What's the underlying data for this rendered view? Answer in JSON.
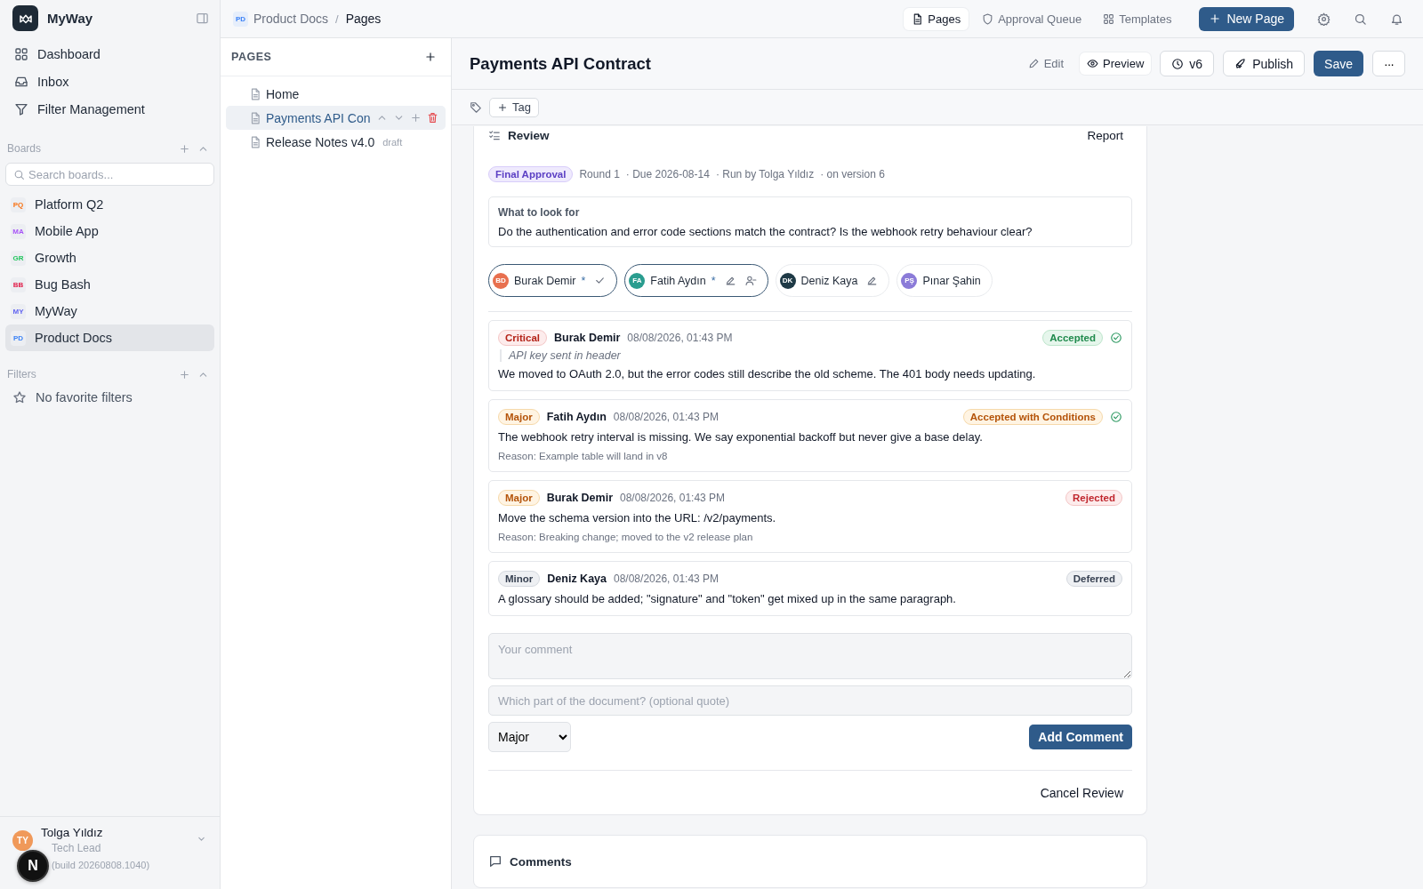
{
  "sidebar": {
    "app_name": "MyWay",
    "nav": [
      {
        "label": "Dashboard",
        "selected": false
      },
      {
        "label": "Inbox",
        "selected": false
      },
      {
        "label": "Filter Management",
        "selected": false
      }
    ],
    "boards_heading": "Boards",
    "board_search": {
      "placeholder": "Search boards..."
    },
    "boards": [
      {
        "initials": "PQ",
        "label": "Platform Q2",
        "color": "#f97316",
        "selected": false
      },
      {
        "initials": "MA",
        "label": "Mobile App",
        "color": "#a855f7",
        "selected": false
      },
      {
        "initials": "GR",
        "label": "Growth",
        "color": "#22c55e",
        "selected": false
      },
      {
        "initials": "BB",
        "label": "Bug Bash",
        "color": "#e11d48",
        "selected": false
      },
      {
        "initials": "MY",
        "label": "MyWay",
        "color": "#6366f1",
        "selected": false
      },
      {
        "initials": "PD",
        "label": "Product Docs",
        "color": "#3b82f6",
        "selected": true
      }
    ],
    "filters_heading": "Filters",
    "filters_empty": "No favorite filters",
    "user": {
      "initials": "TY",
      "name": "Tolga Yıldız",
      "role": "Tech Lead",
      "version": "(build 20260808.1040)"
    },
    "dev_badge": "N"
  },
  "breadcrumb": {
    "initials": "PD",
    "board": "Product Docs",
    "separator": "/",
    "page": "Pages"
  },
  "top_tabs": [
    {
      "label": "Pages",
      "selected": true
    },
    {
      "label": "Approval Queue",
      "selected": false
    },
    {
      "label": "Templates",
      "selected": false
    }
  ],
  "new_page_button": "New Page",
  "pages_panel": {
    "heading": "PAGES",
    "pages": [
      {
        "title": "Home",
        "selected": false
      },
      {
        "title": "Payments API Con",
        "selected": true
      },
      {
        "title": "Release Notes v4.0",
        "tag": "draft",
        "selected": false
      }
    ]
  },
  "document": {
    "title": "Payments API Contract",
    "modes": [
      {
        "label": "Edit",
        "selected": false
      },
      {
        "label": "Preview",
        "selected": true
      }
    ],
    "version_button": "v6",
    "publish_button": "Publish",
    "save_button": "Save",
    "more_button": "···",
    "tag_button": "Tag"
  },
  "review": {
    "title": "Review",
    "report_link": "Report",
    "stage": "Final Approval",
    "meta": [
      "Round 1",
      "· Due 2026-08-14",
      "· Run by Tolga Yıldız",
      "· on version 6"
    ],
    "guidance_title": "What to look for",
    "guidance": "Do the authentication and error code sections match the contract? Is the webhook retry behaviour clear?",
    "reviewers": [
      {
        "initials": "BD",
        "name": "Burak Demir",
        "color": "#e8704f",
        "required": true,
        "required_mark": "*",
        "approved": true,
        "can_edit": false,
        "can_remove": false
      },
      {
        "initials": "FA",
        "name": "Fatih Aydın",
        "color": "#2a9d8f",
        "required": true,
        "required_mark": "*",
        "approved": false,
        "can_edit": true,
        "can_remove": true
      },
      {
        "initials": "DK",
        "name": "Deniz Kaya",
        "color": "#1f3a46",
        "required": false,
        "approved": false,
        "can_edit": true,
        "can_remove": false
      },
      {
        "initials": "PŞ",
        "name": "Pınar Şahin",
        "color": "#8b7bd8",
        "required": false,
        "approved": false,
        "can_edit": false,
        "can_remove": false
      }
    ],
    "comments": [
      {
        "severity": {
          "label": "Critical",
          "kind": "critical"
        },
        "author": "Burak Demir",
        "time": "08/08/2026, 01:43 PM",
        "status": {
          "label": "Accepted",
          "kind": "accepted"
        },
        "resolved": true,
        "quote": "API key sent in header",
        "text": "We moved to OAuth 2.0, but the error codes still describe the old scheme. The 401 body needs updating."
      },
      {
        "severity": {
          "label": "Major",
          "kind": "major"
        },
        "author": "Fatih Aydın",
        "time": "08/08/2026, 01:43 PM",
        "status": {
          "label": "Accepted with Conditions",
          "kind": "conditions"
        },
        "resolved": true,
        "text": "The webhook retry interval is missing. We say exponential backoff but never give a base delay.",
        "reason": "Reason: Example table will land in v8"
      },
      {
        "severity": {
          "label": "Major",
          "kind": "major"
        },
        "author": "Burak Demir",
        "time": "08/08/2026, 01:43 PM",
        "status": {
          "label": "Rejected",
          "kind": "rejected"
        },
        "resolved": false,
        "text": "Move the schema version into the URL: /v2/payments.",
        "reason": "Reason: Breaking change; moved to the v2 release plan"
      },
      {
        "severity": {
          "label": "Minor",
          "kind": "minor"
        },
        "author": "Deniz Kaya",
        "time": "08/08/2026, 01:43 PM",
        "status": {
          "label": "Deferred",
          "kind": "deferred"
        },
        "resolved": false,
        "text": "A glossary should be added; \"signature\" and \"token\" get mixed up in the same paragraph."
      }
    ],
    "comment_field": {
      "placeholder": "Your comment"
    },
    "quote_field": {
      "placeholder": "Which part of the document? (optional quote)"
    },
    "severity_select": "Major",
    "add_button": "Add Comment",
    "cancel_button": "Cancel Review"
  },
  "comments_section": {
    "title": "Comments"
  }
}
